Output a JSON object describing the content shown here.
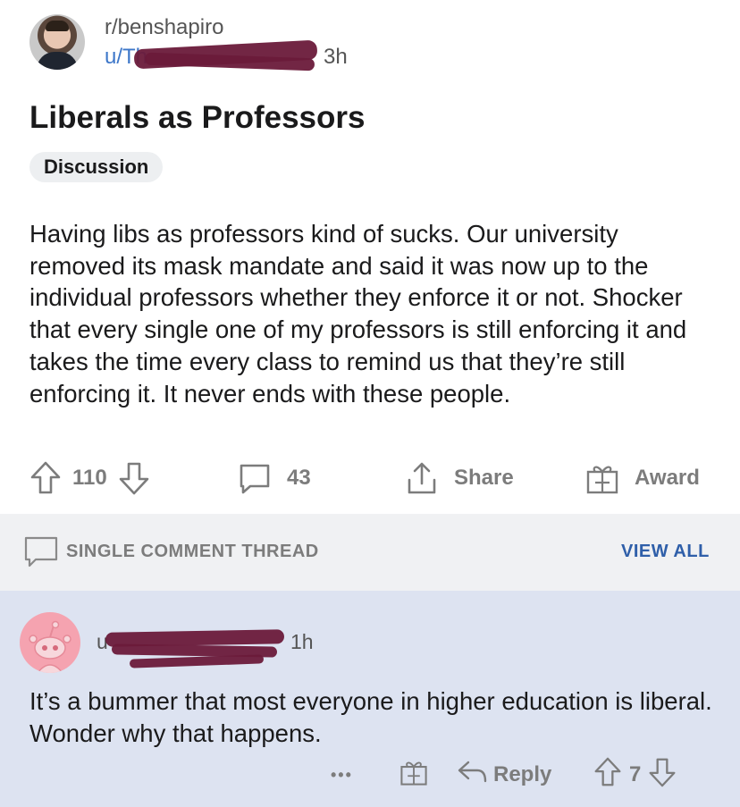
{
  "post": {
    "subreddit": "r/benshapiro",
    "user_prefix": "u/Th",
    "age": "3h",
    "title": "Liberals as Professors",
    "flair": "Discussion",
    "body": "Having libs as professors kind of sucks. Our university removed its mask mandate and said it was now up to the individual professors whether they enforce it or not. Shocker that every single one of my professors is still enforcing it and takes the time every class to remind us that they’re still enforcing it. It never ends with these people.",
    "upvotes": "110",
    "comments": "43",
    "share_label": "Share",
    "award_label": "Award"
  },
  "thread_bar": {
    "label": "SINGLE COMMENT THREAD",
    "view_all": "VIEW ALL"
  },
  "comment": {
    "user_prefix": "u",
    "age": "1h",
    "body": "It’s a bummer that most everyone in higher education is liberal. Wonder why that happens.",
    "more": "•••",
    "reply_label": "Reply",
    "votes": "7"
  },
  "colors": {
    "link": "#3d77c9",
    "view_all": "#2f5fa9",
    "comment_bg": "#dde3f1",
    "redaction": "#6a1a3a"
  }
}
